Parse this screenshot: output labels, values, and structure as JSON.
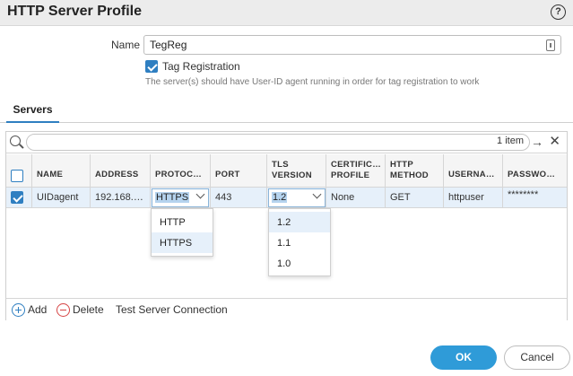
{
  "dialog": {
    "title": "HTTP Server Profile",
    "help_symbol": "?"
  },
  "form": {
    "name_label": "Name",
    "name_value": "TegReg",
    "tag_registration_label": "Tag Registration",
    "tag_registration_checked": true,
    "hint": "The server(s) should have User-ID agent running in order for tag registration to work"
  },
  "tabs": [
    {
      "label": "Servers",
      "active": true
    }
  ],
  "grid": {
    "item_count": "1 item",
    "columns": [
      {
        "line1": "NAME",
        "line2": ""
      },
      {
        "line1": "ADDRESS",
        "line2": ""
      },
      {
        "line1": "PROTOC…",
        "line2": ""
      },
      {
        "line1": "PORT",
        "line2": ""
      },
      {
        "line1": "TLS",
        "line2": "VERSION"
      },
      {
        "line1": "CERTIFIC…",
        "line2": "PROFILE"
      },
      {
        "line1": "HTTP",
        "line2": "METHOD"
      },
      {
        "line1": "USERNA…",
        "line2": ""
      },
      {
        "line1": "PASSWO…",
        "line2": ""
      }
    ],
    "rows": [
      {
        "name": "UIDagent",
        "address": "192.168.…",
        "protocol": "HTTPS",
        "port": "443",
        "tls_version": "1.2",
        "certificate_profile": "None",
        "http_method": "GET",
        "username": "httpuser",
        "password": "********"
      }
    ],
    "protocol_options": [
      "HTTP",
      "HTTPS"
    ],
    "tls_options": [
      "1.2",
      "1.1",
      "1.0"
    ]
  },
  "footer": {
    "add_label": "Add",
    "delete_label": "Delete",
    "test_label": "Test Server Connection"
  },
  "buttons": {
    "ok": "OK",
    "cancel": "Cancel"
  },
  "colors": {
    "accent": "#2f7fc1",
    "ok_button": "#2f9bd8",
    "selection": "#e6f0fa",
    "highlight": "#b5d3ee",
    "delete": "#d64545"
  }
}
